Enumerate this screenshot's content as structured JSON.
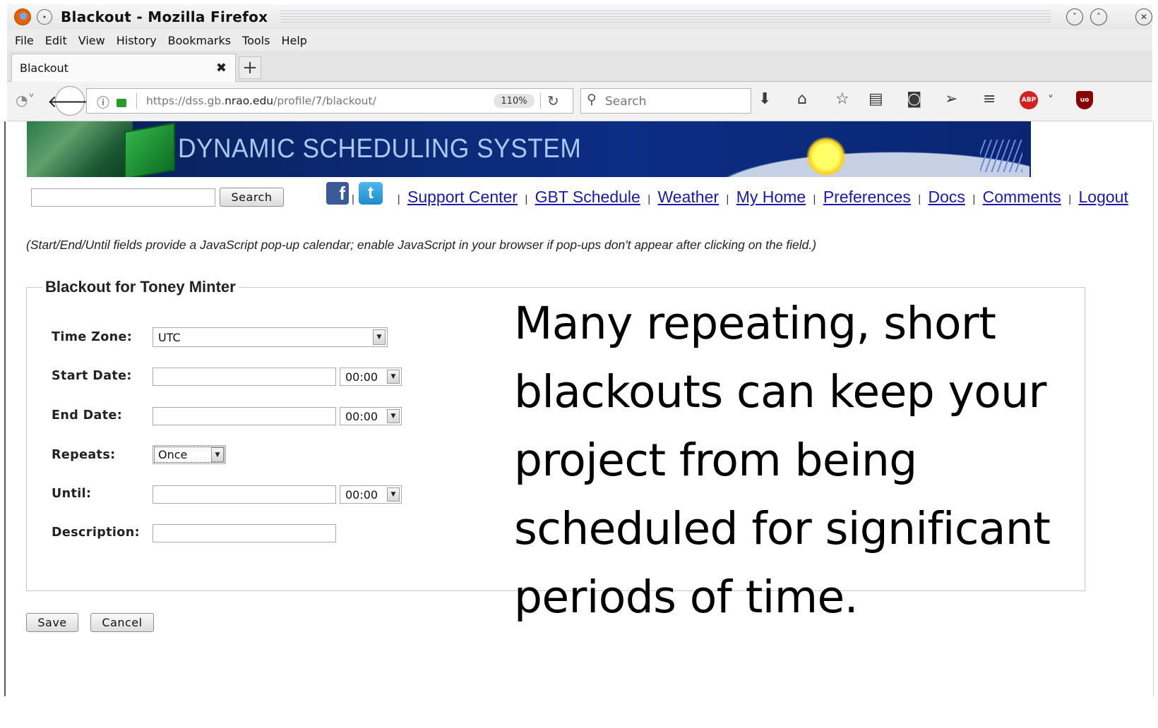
{
  "window": {
    "title": "Blackout - Mozilla Firefox"
  },
  "menu": [
    "File",
    "Edit",
    "View",
    "History",
    "Bookmarks",
    "Tools",
    "Help"
  ],
  "tab": {
    "label": "Blackout"
  },
  "navbar": {
    "url_prefix": "https://dss.gb.",
    "url_domain": "nrao.edu",
    "url_path": "/profile/7/blackout/",
    "zoom": "110%",
    "search_placeholder": "Search"
  },
  "banner": {
    "title": "DYNAMIC SCHEDULING SYSTEM"
  },
  "site_search": {
    "button": "Search",
    "value": ""
  },
  "social": {
    "facebook": "f",
    "twitter": "t"
  },
  "links": [
    "Support Center",
    "GBT Schedule",
    "Weather",
    "My Home",
    "Preferences",
    "Docs",
    "Comments",
    "Logout"
  ],
  "link_separator": "|",
  "note": "(Start/End/Until fields provide a JavaScript pop-up calendar; enable JavaScript in your browser if pop-ups don't appear after clicking on the field.)",
  "form": {
    "legend": "Blackout for Toney Minter",
    "time_zone": {
      "label": "Time Zone:",
      "value": "UTC"
    },
    "start_date": {
      "label": "Start Date:",
      "value": "",
      "time": "00:00"
    },
    "end_date": {
      "label": "End Date:",
      "value": "",
      "time": "00:00"
    },
    "repeats": {
      "label": "Repeats:",
      "value": "Once"
    },
    "until": {
      "label": "Until:",
      "value": "",
      "time": "00:00"
    },
    "description": {
      "label": "Description:",
      "value": ""
    },
    "save": "Save",
    "cancel": "Cancel"
  },
  "overlay_text": "Many repeating, short blackouts can keep your project from being scheduled for significant periods of time."
}
